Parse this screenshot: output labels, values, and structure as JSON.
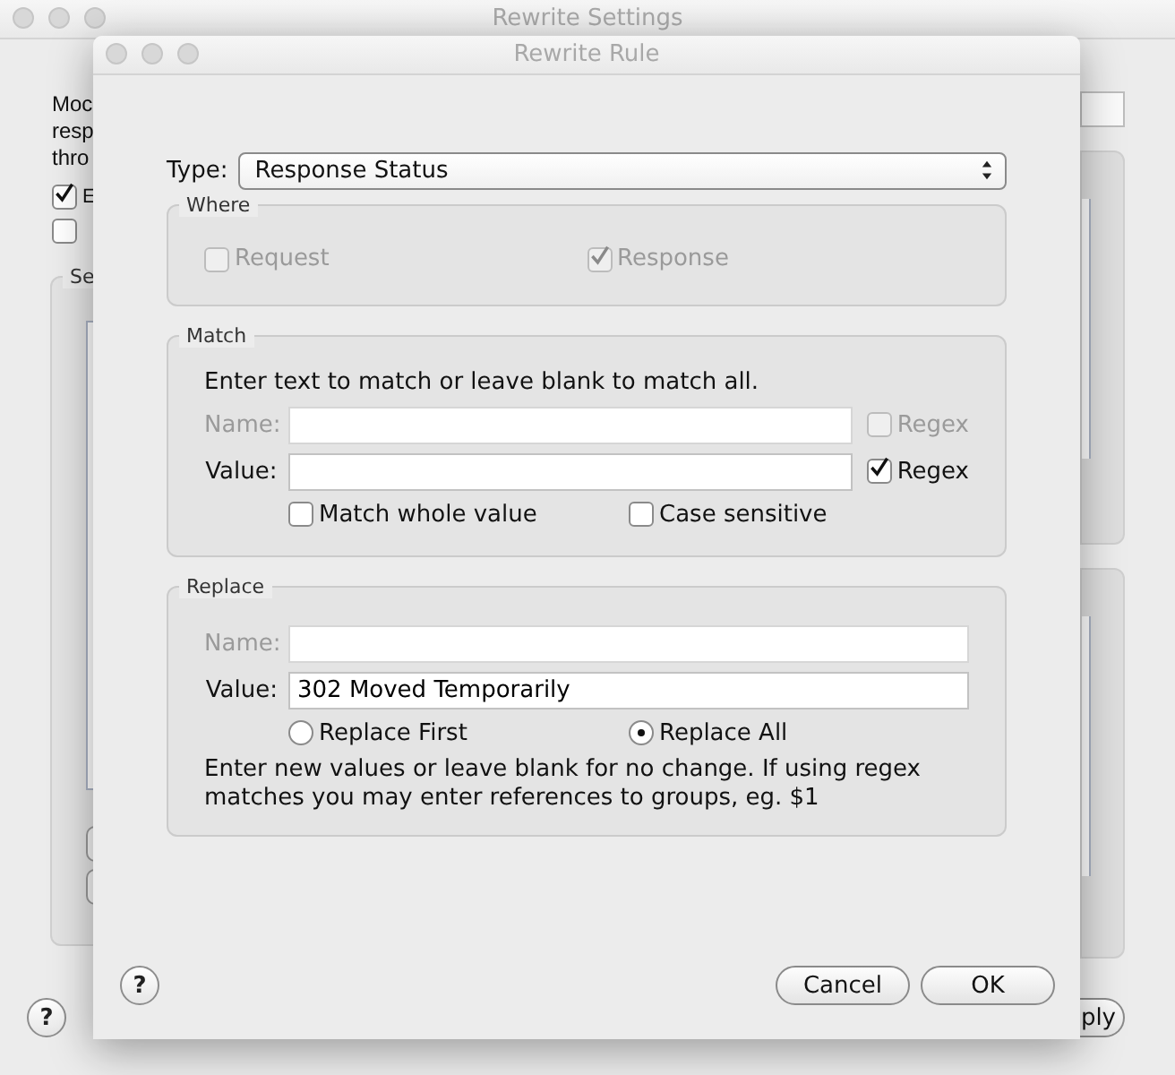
{
  "background_window": {
    "title": "Rewrite Settings",
    "description_lines": [
      "Moc",
      "resp",
      "thro"
    ],
    "checkboxes": [
      {
        "label": "E",
        "checked": true
      },
      {
        "checked": false
      }
    ],
    "group_title": "Se",
    "help": "?",
    "apply_button": "ply"
  },
  "dialog": {
    "title": "Rewrite Rule",
    "type": {
      "label": "Type:",
      "value": "Response Status"
    },
    "where": {
      "title": "Where",
      "options": [
        {
          "label": "Request",
          "checked": false,
          "disabled": true
        },
        {
          "label": "Response",
          "checked": true,
          "disabled": true
        }
      ]
    },
    "match": {
      "title": "Match",
      "hint": "Enter text to match or leave blank to match all.",
      "fields": [
        {
          "label": "Name:",
          "disabled": true,
          "regex": {
            "label": "Regex",
            "checked": false,
            "disabled": true
          }
        },
        {
          "label": "Value:",
          "disabled": false,
          "regex": {
            "label": "Regex",
            "checked": true,
            "disabled": false
          }
        }
      ],
      "options": [
        {
          "label": "Match whole value",
          "checked": false
        },
        {
          "label": "Case sensitive",
          "checked": false
        }
      ]
    },
    "replace": {
      "title": "Replace",
      "fields": [
        {
          "label": "Name:",
          "disabled": true
        },
        {
          "label": "Value:",
          "value": "302 Moved Temporarily",
          "disabled": false
        }
      ],
      "modes": [
        {
          "label": "Replace First",
          "selected": false
        },
        {
          "label": "Replace All",
          "selected": true
        }
      ],
      "note": "Enter new values or leave blank for no change. If using regex matches you may enter references to groups, eg. $1"
    },
    "help": "?",
    "buttons": [
      "Cancel",
      "OK"
    ]
  }
}
